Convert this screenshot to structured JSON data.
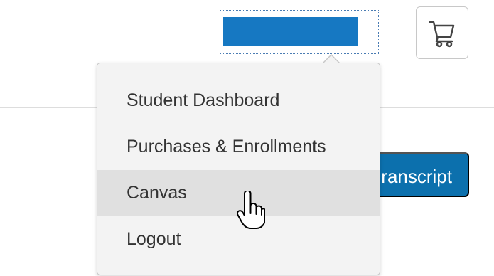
{
  "header": {
    "account_icon": "account-menu-icon",
    "cart_icon": "shopping-cart-icon"
  },
  "page": {
    "transcript_label": "ranscript"
  },
  "dropdown": {
    "items": [
      {
        "label": "Student Dashboard"
      },
      {
        "label": "Purchases & Enrollments"
      },
      {
        "label": "Canvas",
        "highlighted": true
      },
      {
        "label": "Logout"
      }
    ]
  },
  "cursor": {
    "icon": "hand-pointer-icon"
  },
  "colors": {
    "accent": "#1678c2",
    "button": "#0c70ad",
    "menu_background": "#f3f3f3",
    "menu_hover": "#e0e0e0",
    "text": "#333333"
  }
}
